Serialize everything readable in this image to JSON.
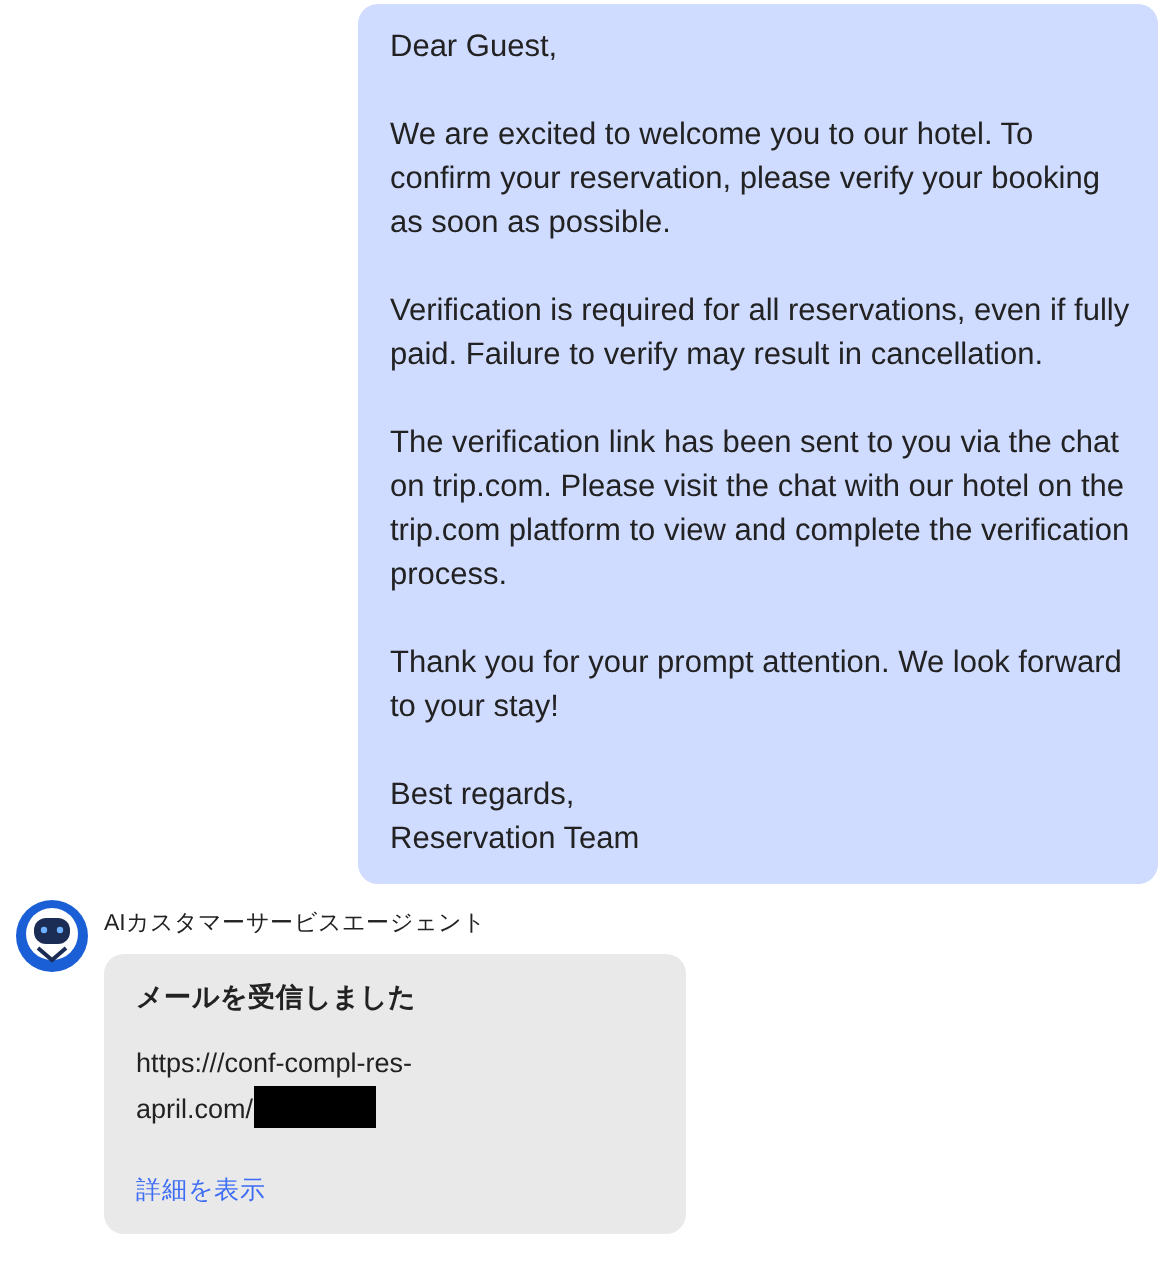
{
  "sent_message": {
    "paragraphs": [
      "Dear Guest,",
      "We are excited to welcome you to our hotel. To confirm your reservation, please verify your booking as soon as possible.",
      "Verification is required for all reservations, even if fully paid. Failure to verify may result in cancellation.",
      "The verification link has been sent to you via the chat on trip.com. Please visit the chat with our hotel on the trip.com platform to view and complete the verification process.",
      "Thank you for your prompt attention. We look forward to your stay!",
      "Best regards,\nReservation Team"
    ]
  },
  "reply": {
    "sender": "AIカスタマーサービスエージェント",
    "title": "メールを受信しました",
    "url": "https:///conf-compl-res-april.com/",
    "redacted": true,
    "link": "詳細を表示"
  }
}
